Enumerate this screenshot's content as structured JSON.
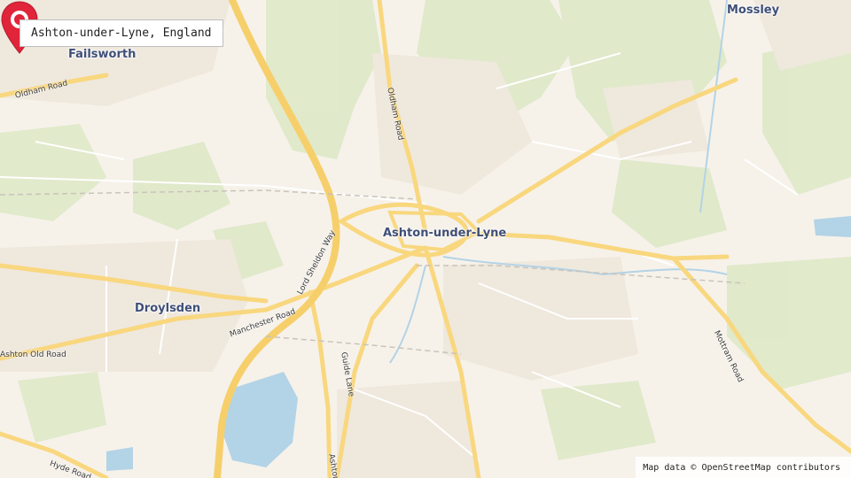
{
  "search": {
    "query": "Ashton-under-Lyne, England"
  },
  "places": {
    "ashton": "Ashton-under-Lyne",
    "failsworth": "Failsworth",
    "mossley": "Mossley",
    "droylsden": "Droylsden"
  },
  "roads": {
    "oldham_road_west": "Oldham Road",
    "oldham_road_north": "Oldham Road",
    "lord_sheldon_way": "Lord Sheldon Way",
    "manchester_road": "Manchester Road",
    "ashton_old_road": "Ashton Old Road",
    "guide_lane": "Guide Lane",
    "mottram_road": "Mottram Road",
    "hyde_road": "Hyde Road",
    "ashton_south": "Ashton"
  },
  "attribution": "Map data © OpenStreetMap contributors",
  "marker": {
    "icon": "map-pin-icon",
    "color": "#e0243a"
  },
  "colors": {
    "land": "#f6f2ea",
    "green": "#dfe9c9",
    "road_major": "#f9d77e",
    "road_minor": "#ffffff",
    "water": "#b3d3e6"
  }
}
